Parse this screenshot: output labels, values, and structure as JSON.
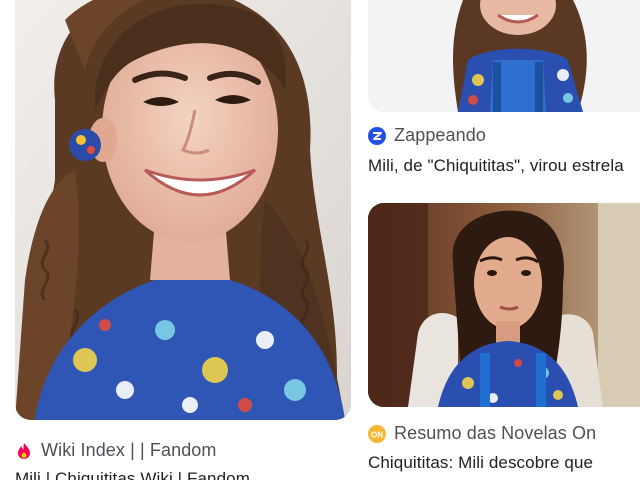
{
  "results": [
    {
      "source": "Wiki Index | | Fandom",
      "source_icon": "fandom-flame-icon",
      "title": "Mili | Chiquititas Wiki | Fandom",
      "image": "portrait-smiling-girl-braided-hair"
    },
    {
      "source": "Zappeando",
      "source_icon": "zappeando-logo-icon",
      "title": "Mili, de \"Chiquititas\", virou estrela",
      "image": "photo-girl-blue-overalls"
    },
    {
      "source": "Resumo das Novelas On",
      "source_icon": "on-logo-icon",
      "title": "Chiquititas: Mili descobre que",
      "image": "tv-still-girl-serious"
    }
  ],
  "colors": {
    "fandom": "#fa005a",
    "zappeando": "#2450e6",
    "on": "#f7b733",
    "text_primary": "#202124",
    "text_secondary": "#4d5156"
  }
}
